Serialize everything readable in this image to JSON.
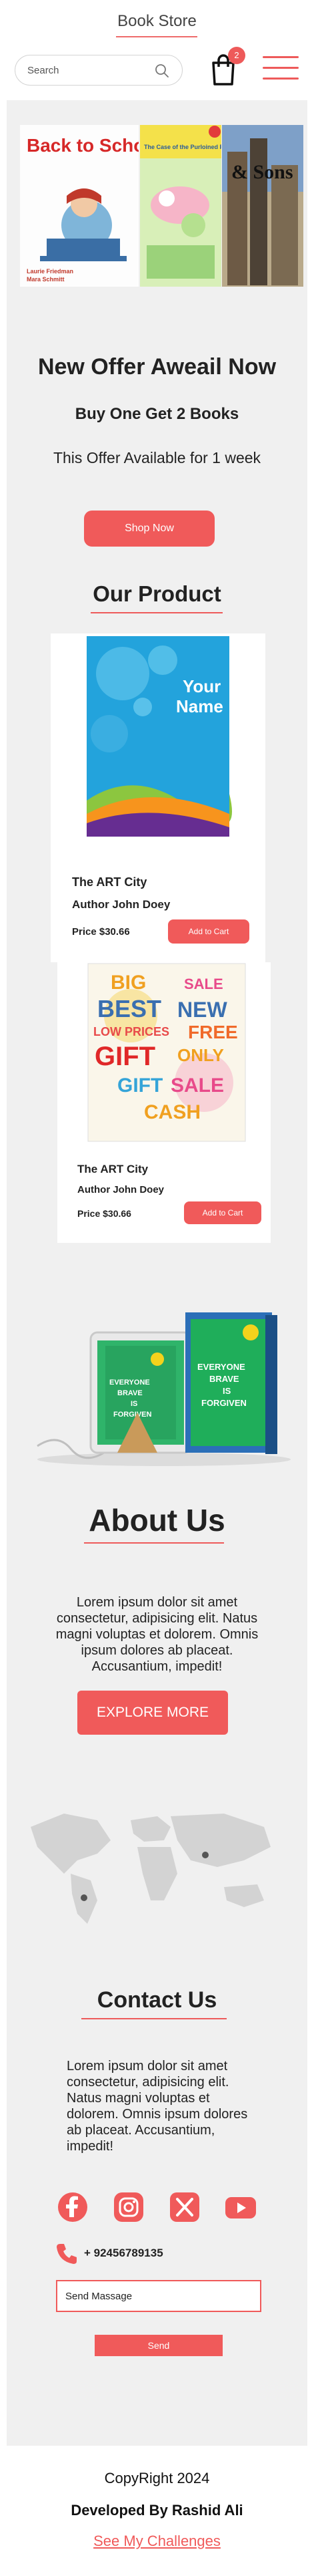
{
  "header": {
    "title": "Book Store",
    "search": {
      "placeholder": "Search"
    },
    "cart_count": "2"
  },
  "hero": {
    "books": [
      {
        "title": "Back to School, Mallory",
        "author": "Laurie Friedman",
        "illustrator": "Mara Schmitt"
      },
      {
        "title": "The Case of the Purloined Pig"
      },
      {
        "title": "& Sons"
      }
    ]
  },
  "offer": {
    "title": "New Offer Aweail Now",
    "subtitle": "Buy One Get 2 Books",
    "note": "This Offer Available for 1 week",
    "button": "Shop Now"
  },
  "products": {
    "section_title": "Our Product",
    "items": [
      {
        "cover_text_1": "Your",
        "cover_text_2": "Name",
        "title": "The ART City",
        "author": "Author John Doey",
        "price": "Price $30.66",
        "cart_label": "Add to Cart"
      },
      {
        "cover_words": [
          "BIG",
          "SALE",
          "BEST",
          "NEW",
          "LOW PRICES",
          "FREE",
          "GIFT",
          "ONLY",
          "GIFT",
          "SALE",
          "CASH"
        ],
        "title": "The ART City",
        "author": "Author John Doey",
        "price": "Price $30.66",
        "cart_label": "Add to Cart"
      }
    ],
    "showcase_book": {
      "title_lines": [
        "EVERYONE",
        "BRAVE",
        "IS",
        "FORGIVEN"
      ]
    }
  },
  "about": {
    "title": "About Us",
    "text": "Lorem ipsum dolor sit amet consectetur, adipisicing elit. Natus magni voluptas et dolorem. Omnis ipsum dolores ab placeat. Accusantium, impedit!",
    "button": "EXPLORE MORE"
  },
  "contact": {
    "title": "Contact Us",
    "text": "Lorem ipsum dolor sit amet consectetur, adipisicing elit. Natus magni voluptas et dolorem. Omnis ipsum dolores ab placeat. Accusantium, impedit!",
    "social": [
      "facebook-icon",
      "instagram-icon",
      "x-icon",
      "youtube-icon"
    ],
    "phone": "+ 92456789135",
    "message_placeholder": "Send Massage",
    "send_button": "Send"
  },
  "footer": {
    "copyright": "CopyRight 2024",
    "developer": "Developed By Rashid Ali",
    "link": "See My Challenges"
  },
  "colors": {
    "accent": "#f05a5a",
    "background": "#f0f0f0"
  }
}
